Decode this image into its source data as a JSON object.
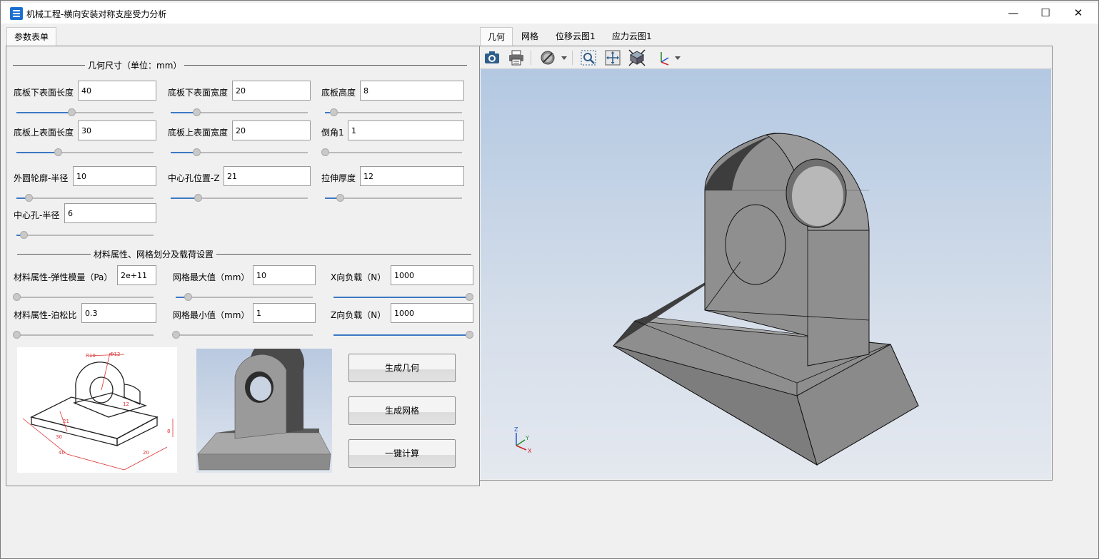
{
  "window": {
    "title": "机械工程-横向安装对称支座受力分析",
    "controls": {
      "minimize": "—",
      "maximize": "☐",
      "close": "✕"
    }
  },
  "left_tabs": [
    "参数表单"
  ],
  "right_tabs": [
    "几何",
    "网格",
    "位移云图1",
    "应力云图1"
  ],
  "geometry_section": {
    "title": "几何尺寸（单位：mm）",
    "fields": [
      {
        "label": "底板下表面长度",
        "value": "40",
        "slider": 0.4
      },
      {
        "label": "底板下表面宽度",
        "value": "20",
        "slider": 0.19
      },
      {
        "label": "底板高度",
        "value": "8",
        "slider": 0.06
      },
      {
        "label": "底板上表面长度",
        "value": "30",
        "slider": 0.3
      },
      {
        "label": "底板上表面宽度",
        "value": "20",
        "slider": 0.19
      },
      {
        "label": "倒角1",
        "value": "1",
        "slider": 0.0
      },
      {
        "label": "外圆轮廓-半径",
        "value": "10",
        "slider": 0.09
      },
      {
        "label": "中心孔位置-Z",
        "value": "21",
        "slider": 0.2
      },
      {
        "label": "拉伸厚度",
        "value": "12",
        "slider": 0.11
      },
      {
        "label": "中心孔-半径",
        "value": "6",
        "slider": 0.05
      }
    ]
  },
  "material_section": {
    "title": "材料属性、网格划分及载荷设置",
    "fields": [
      {
        "label": "材料属性-弹性模量（Pa）",
        "value": "2e+11",
        "slider": 0.0
      },
      {
        "label": "网格最大值（mm）",
        "value": "10",
        "slider": 0.09
      },
      {
        "label": "X向负载（N）",
        "value": "1000",
        "slider": 1.0
      },
      {
        "label": "材料属性-泊松比",
        "value": "0.3",
        "slider": 0.0
      },
      {
        "label": "网格最小值（mm）",
        "value": "1",
        "slider": 0.0
      },
      {
        "label": "Z向负载（N）",
        "value": "1000",
        "slider": 1.0
      }
    ]
  },
  "buttons": {
    "generate_geometry": "生成几何",
    "generate_mesh": "生成网格",
    "one_click_compute": "一键计算"
  },
  "drawing_labels": {
    "r10": "R10",
    "d12": "Φ12",
    "h21": "21",
    "w12": "12",
    "l30": "30",
    "l40": "40",
    "w20": "20",
    "h8": "8"
  },
  "toolbar_icons": [
    "camera-icon",
    "print-icon",
    "display-mode-icon",
    "zoom-window-icon",
    "fit-all-icon",
    "view-iso-icon",
    "axis-triad-icon"
  ],
  "axis_triad": {
    "x": "X",
    "y": "Y",
    "z": "Z"
  },
  "colors": {
    "accent": "#3b78c4",
    "viewport_top": "#b3c8e2",
    "viewport_bottom": "#e4e8ef",
    "model_gray": "#8c8c8c"
  }
}
